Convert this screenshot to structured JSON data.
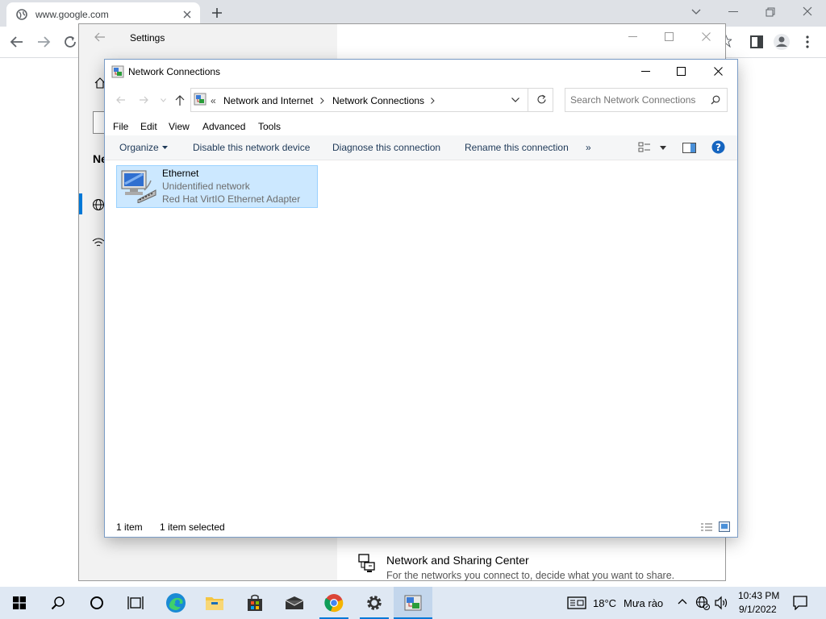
{
  "browser": {
    "tab_title": "www.google.com"
  },
  "settings": {
    "title": "Settings",
    "nav_heading": "Ne",
    "sharing_center": {
      "title": "Network and Sharing Center",
      "description": "For the networks you connect to, decide what you want to share."
    }
  },
  "explorer": {
    "title": "Network Connections",
    "breadcrumb": {
      "overflow": "«",
      "items": [
        "Network and Internet",
        "Network Connections"
      ]
    },
    "search_placeholder": "Search Network Connections",
    "menu": [
      "File",
      "Edit",
      "View",
      "Advanced",
      "Tools"
    ],
    "commands": {
      "organize": "Organize",
      "disable": "Disable this network device",
      "diagnose": "Diagnose this connection",
      "rename": "Rename this connection",
      "more": "»"
    },
    "items": [
      {
        "name": "Ethernet",
        "status": "Unidentified network",
        "adapter": "Red Hat VirtIO Ethernet Adapter"
      }
    ],
    "status": {
      "count": "1 item",
      "selected": "1 item selected"
    }
  },
  "taskbar": {
    "weather": "18°C",
    "weather_desc": "Mưa rào",
    "time": "10:43 PM",
    "date": "9/1/2022"
  },
  "colors": {
    "selection": "#cce8ff",
    "selection_border": "#99d1ff",
    "taskbar": "#dfe8f3",
    "accent": "#0078d7"
  }
}
